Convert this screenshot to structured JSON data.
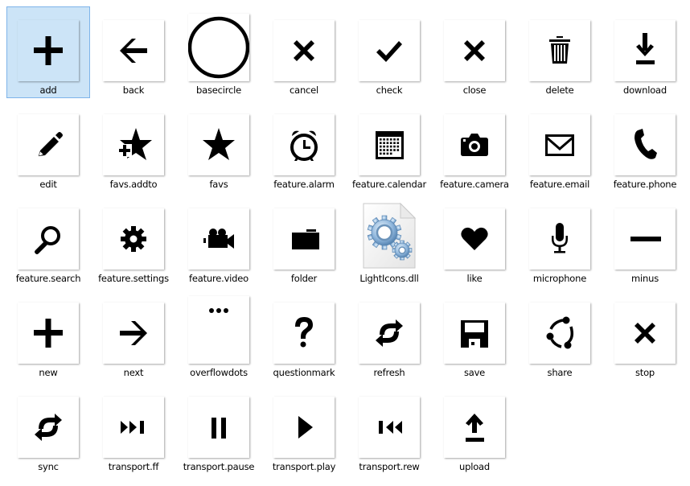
{
  "view": "large-icons",
  "selected_index": 0,
  "items": [
    {
      "label": "add",
      "icon": "plus-icon",
      "type": "png"
    },
    {
      "label": "back",
      "icon": "arrow-left-icon",
      "type": "png"
    },
    {
      "label": "basecircle",
      "icon": "circle-icon",
      "type": "png"
    },
    {
      "label": "cancel",
      "icon": "x-icon",
      "type": "png"
    },
    {
      "label": "check",
      "icon": "checkmark-icon",
      "type": "png"
    },
    {
      "label": "close",
      "icon": "x-icon",
      "type": "png"
    },
    {
      "label": "delete",
      "icon": "trash-icon",
      "type": "png"
    },
    {
      "label": "download",
      "icon": "download-icon",
      "type": "png"
    },
    {
      "label": "edit",
      "icon": "pencil-icon",
      "type": "png"
    },
    {
      "label": "favs.addto",
      "icon": "star-plus-icon",
      "type": "png"
    },
    {
      "label": "favs",
      "icon": "star-icon",
      "type": "png"
    },
    {
      "label": "feature.alarm",
      "icon": "alarm-clock-icon",
      "type": "png"
    },
    {
      "label": "feature.calendar",
      "icon": "calendar-icon",
      "type": "png"
    },
    {
      "label": "feature.camera",
      "icon": "camera-icon",
      "type": "png"
    },
    {
      "label": "feature.email",
      "icon": "envelope-icon",
      "type": "png"
    },
    {
      "label": "feature.phone",
      "icon": "phone-icon",
      "type": "png"
    },
    {
      "label": "feature.search",
      "icon": "magnifier-icon",
      "type": "png"
    },
    {
      "label": "feature.settings",
      "icon": "gear-icon",
      "type": "png"
    },
    {
      "label": "feature.video",
      "icon": "video-camera-icon",
      "type": "png"
    },
    {
      "label": "folder",
      "icon": "folder-icon",
      "type": "png"
    },
    {
      "label": "LightIcons.dll",
      "icon": "dll-file-gears-icon",
      "type": "dll"
    },
    {
      "label": "like",
      "icon": "heart-icon",
      "type": "png"
    },
    {
      "label": "microphone",
      "icon": "microphone-icon",
      "type": "png"
    },
    {
      "label": "minus",
      "icon": "minus-icon",
      "type": "png"
    },
    {
      "label": "new",
      "icon": "plus-icon",
      "type": "png"
    },
    {
      "label": "next",
      "icon": "arrow-right-icon",
      "type": "png"
    },
    {
      "label": "overflowdots",
      "icon": "ellipsis-icon",
      "type": "png"
    },
    {
      "label": "questionmark",
      "icon": "question-mark-icon",
      "type": "png"
    },
    {
      "label": "refresh",
      "icon": "refresh-icon",
      "type": "png"
    },
    {
      "label": "save",
      "icon": "floppy-disk-icon",
      "type": "png"
    },
    {
      "label": "share",
      "icon": "share-icon",
      "type": "png"
    },
    {
      "label": "stop",
      "icon": "x-icon",
      "type": "png"
    },
    {
      "label": "sync",
      "icon": "sync-icon",
      "type": "png"
    },
    {
      "label": "transport.ff",
      "icon": "fast-forward-icon",
      "type": "png"
    },
    {
      "label": "transport.pause",
      "icon": "pause-icon",
      "type": "png"
    },
    {
      "label": "transport.play",
      "icon": "play-icon",
      "type": "png"
    },
    {
      "label": "transport.rew",
      "icon": "rewind-icon",
      "type": "png"
    },
    {
      "label": "upload",
      "icon": "upload-icon",
      "type": "png"
    }
  ],
  "colors": {
    "selection_fill": "#cce4f7",
    "selection_border": "#7eb4ea",
    "glyph": "#000000"
  }
}
